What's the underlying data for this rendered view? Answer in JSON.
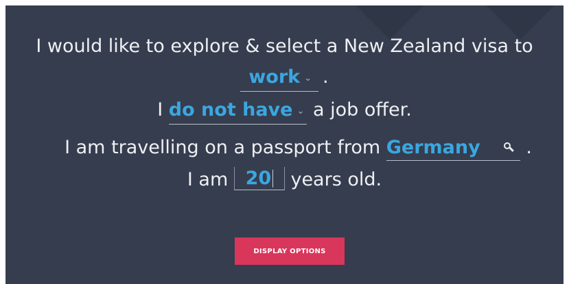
{
  "form": {
    "line1": "I would like to explore & select a New Zealand visa to",
    "purpose": {
      "value": "work",
      "caret": "⌄"
    },
    "period": ".",
    "line3_prefix": "I",
    "job_offer": {
      "value": "do not have",
      "caret": "⌄"
    },
    "line3_suffix": "a job offer.",
    "line4_prefix": "I am travelling on a passport from",
    "passport": {
      "value": "Germany",
      "icon": "search-icon"
    },
    "line5_prefix": "I am",
    "age": {
      "value": "20"
    },
    "line5_suffix": "years old."
  },
  "actions": {
    "display_options_label": "DISPLAY OPTIONS"
  },
  "colors": {
    "background": "#363d4e",
    "accent_text": "#3aa7e0",
    "button": "#d9365b",
    "text": "#eef0f4"
  }
}
